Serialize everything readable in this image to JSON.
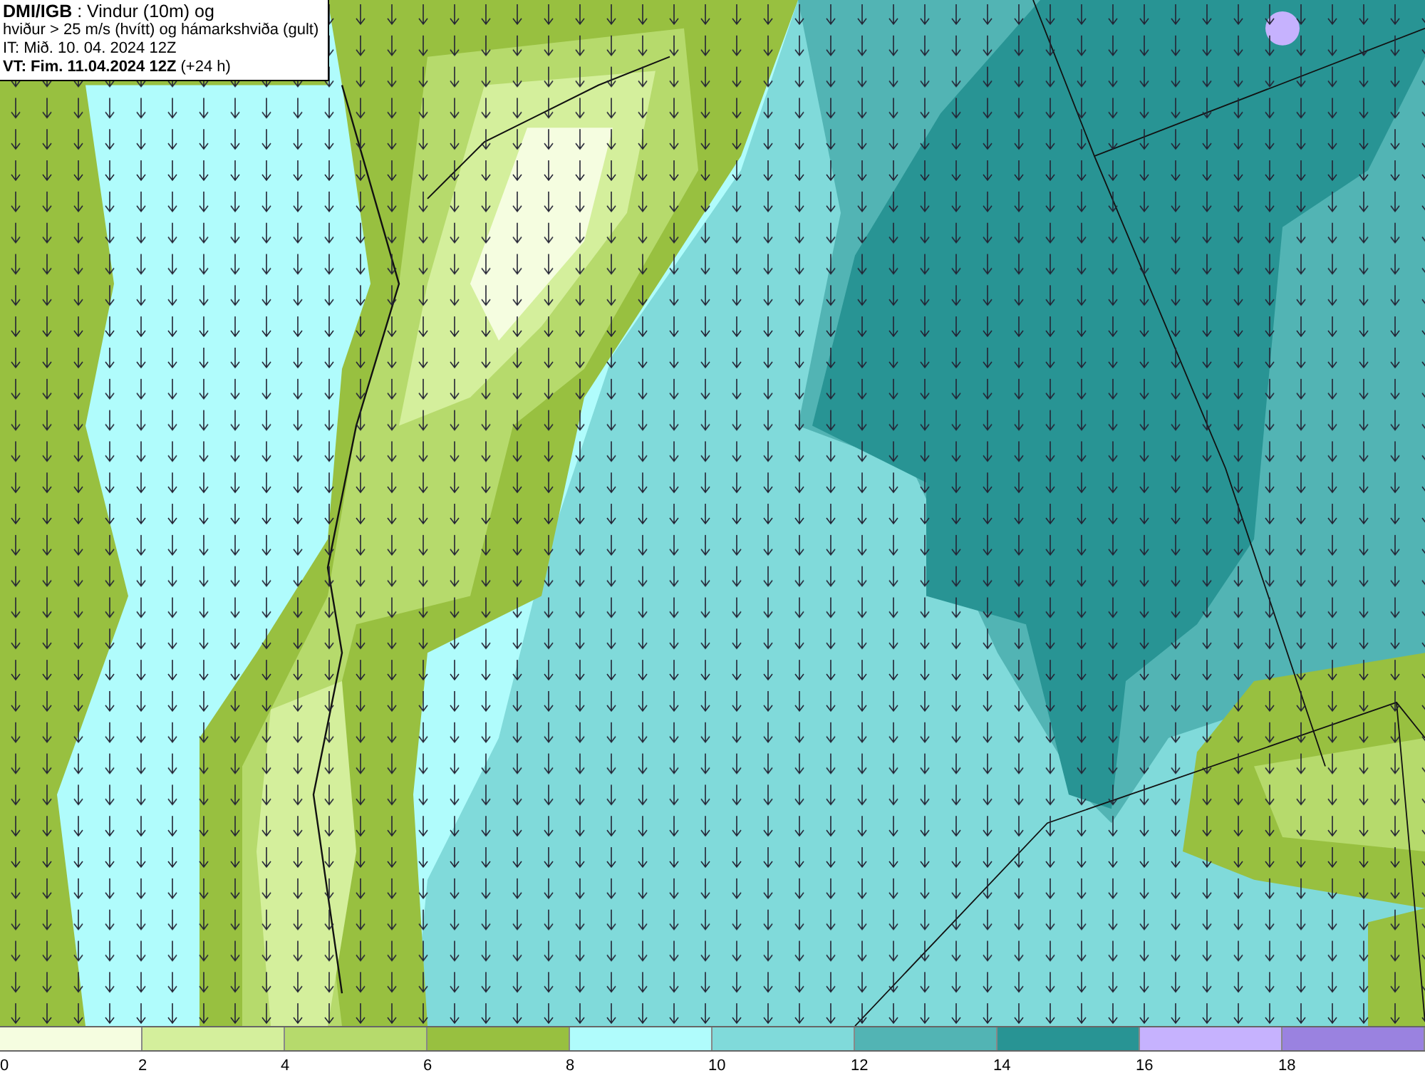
{
  "title_box": {
    "lines": [
      "**DMI/IGB** : Vindur (10m) og",
      "hviður > 25 m/s (hvítt) og hámarkshviða (gult)",
      "IT: Mið. 10. 04. 2024 12Z",
      "**VT: Fim. 11.04.2024 12Z** (+24 h)"
    ]
  },
  "legend": {
    "bins": [
      {
        "label": "0",
        "color": "#f5fde0"
      },
      {
        "label": "2",
        "color": "#d4ef9c"
      },
      {
        "label": "4",
        "color": "#b6da6c"
      },
      {
        "label": "6",
        "color": "#98c040"
      },
      {
        "label": "8",
        "color": "#b0fcfc"
      },
      {
        "label": "10",
        "color": "#80dada"
      },
      {
        "label": "12",
        "color": "#52b4b4"
      },
      {
        "label": "14",
        "color": "#289494"
      },
      {
        "label": "16",
        "color": "#c6b2fe"
      },
      {
        "label": "18",
        "color": "#9a82e0"
      }
    ]
  }
}
